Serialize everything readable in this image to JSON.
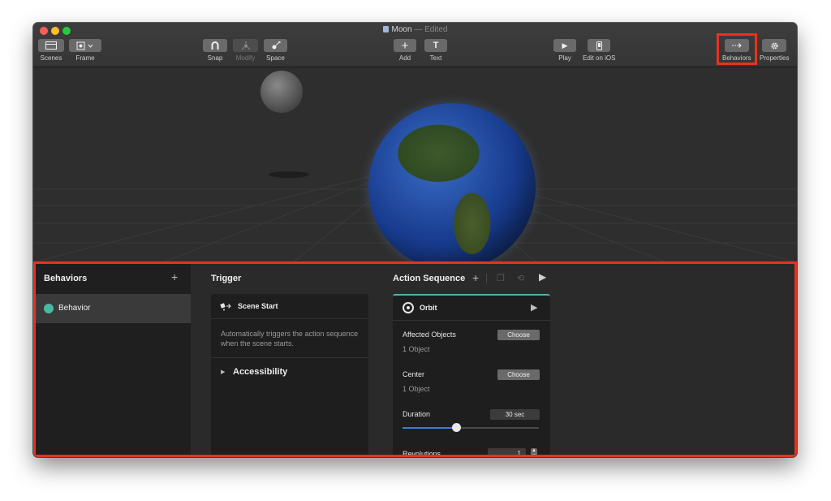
{
  "window": {
    "title": "Moon",
    "status": "— Edited"
  },
  "toolbar": {
    "scenes": "Scenes",
    "frame": "Frame",
    "snap": "Snap",
    "modify": "Modify",
    "space": "Space",
    "add": "Add",
    "text": "Text",
    "play": "Play",
    "edit_on_ios": "Edit on iOS",
    "behaviors": "Behaviors",
    "properties": "Properties"
  },
  "sidebar": {
    "title": "Behaviors",
    "add_symbol": "+",
    "items": [
      {
        "label": "Behavior",
        "color": "#49b9a3"
      }
    ]
  },
  "trigger": {
    "title": "Trigger",
    "card_title": "Scene Start",
    "description": "Automatically triggers the action sequence when the scene starts.",
    "accessibility": "Accessibility"
  },
  "action_sequence": {
    "title": "Action Sequence",
    "add_symbol": "+",
    "card_title": "Orbit",
    "affected_objects_label": "Affected Objects",
    "affected_objects_value": "1 Object",
    "choose_label": "Choose",
    "center_label": "Center",
    "center_value": "1 Object",
    "duration_label": "Duration",
    "duration_value": "30 sec",
    "duration_slider_fraction": 0.39,
    "revolutions_label": "Revolutions",
    "revolutions_value": "1"
  },
  "colors": {
    "highlight": "#e8321e",
    "accent_teal": "#49b9a3",
    "slider_blue": "#3c7bd9"
  }
}
